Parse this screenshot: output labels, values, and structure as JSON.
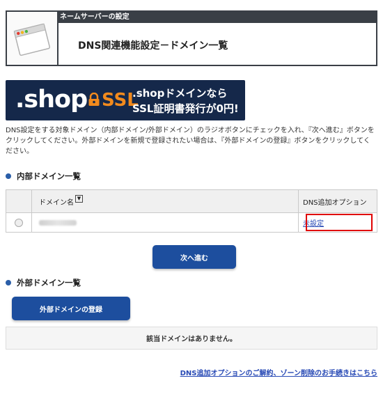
{
  "header": {
    "section_label": "ネームサーバーの設定",
    "title": "DNS関連機能設定－ドメイン一覧"
  },
  "banner": {
    "brand": ".shop",
    "brand_ssl": "SSL",
    "promo_line1": ".shopドメインなら",
    "promo_line2": "SSL証明書発行が0円!",
    "colors": {
      "background": "#15284a",
      "accent": "#f28a1d"
    }
  },
  "description": "DNS設定をする対象ドメイン（内部ドメイン/外部ドメイン）のラジオボタンにチェックを入れ、『次へ進む』ボタンをクリックしてください。外部ドメインを新規で登録されたい場合は、『外部ドメインの登録』ボタンをクリックしてください。",
  "internal": {
    "heading": "内部ドメイン一覧",
    "table": {
      "col_domain": "ドメイン名",
      "sort_icon": "▼",
      "col_option": "DNS追加オプション",
      "rows": [
        {
          "domain": "",
          "option": "未設定"
        }
      ]
    },
    "next_button": "次へ進む"
  },
  "external": {
    "heading": "外部ドメイン一覧",
    "register_button": "外部ドメインの登録",
    "empty_message": "該当ドメインはありません。"
  },
  "footer_link": "DNS追加オプションのご解約、ゾーン削除のお手続きはこちら",
  "colors": {
    "button": "#1d4e9e",
    "link": "#2749b5",
    "highlight": "#e00000",
    "header_bar": "#3a3f46"
  }
}
